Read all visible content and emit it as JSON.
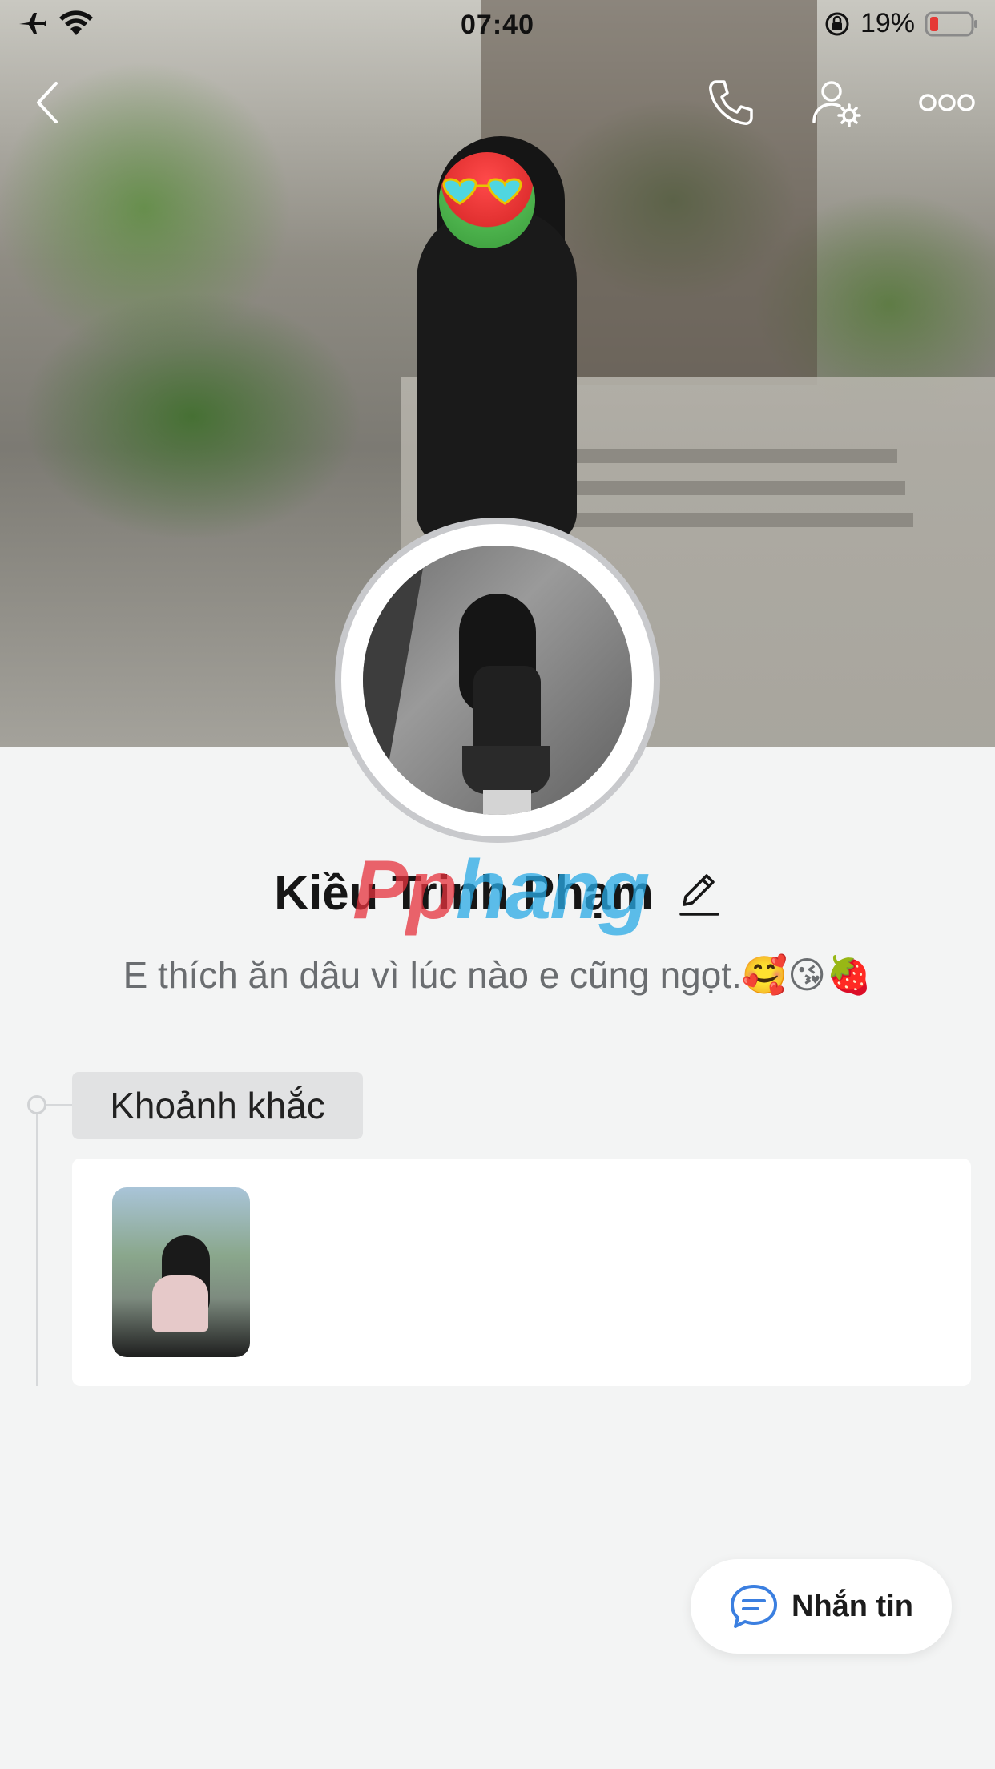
{
  "status_bar": {
    "time": "07:40",
    "battery_percent": "19%",
    "icons": [
      "airplane-icon",
      "wifi-icon",
      "rotation-lock-icon",
      "battery-icon"
    ]
  },
  "top_nav": {
    "icons": [
      "back-icon",
      "phone-icon",
      "user-settings-icon",
      "more-icon"
    ]
  },
  "profile": {
    "name": "Kiều Trinh Phạm",
    "bio": "E thích ăn dâu vì lúc nào e cũng ngọt.🥰😘🍓"
  },
  "watermark": {
    "part1": "Pp",
    "part2": "hang"
  },
  "moments": {
    "label": "Khoảnh khắc",
    "thumbnails": 1
  },
  "message_button": {
    "label": "Nhắn tin",
    "icon": "chat-bubble-icon"
  },
  "colors": {
    "accent": "#3b7fe0",
    "battery_low": "#e53935",
    "background": "#f3f4f4"
  }
}
